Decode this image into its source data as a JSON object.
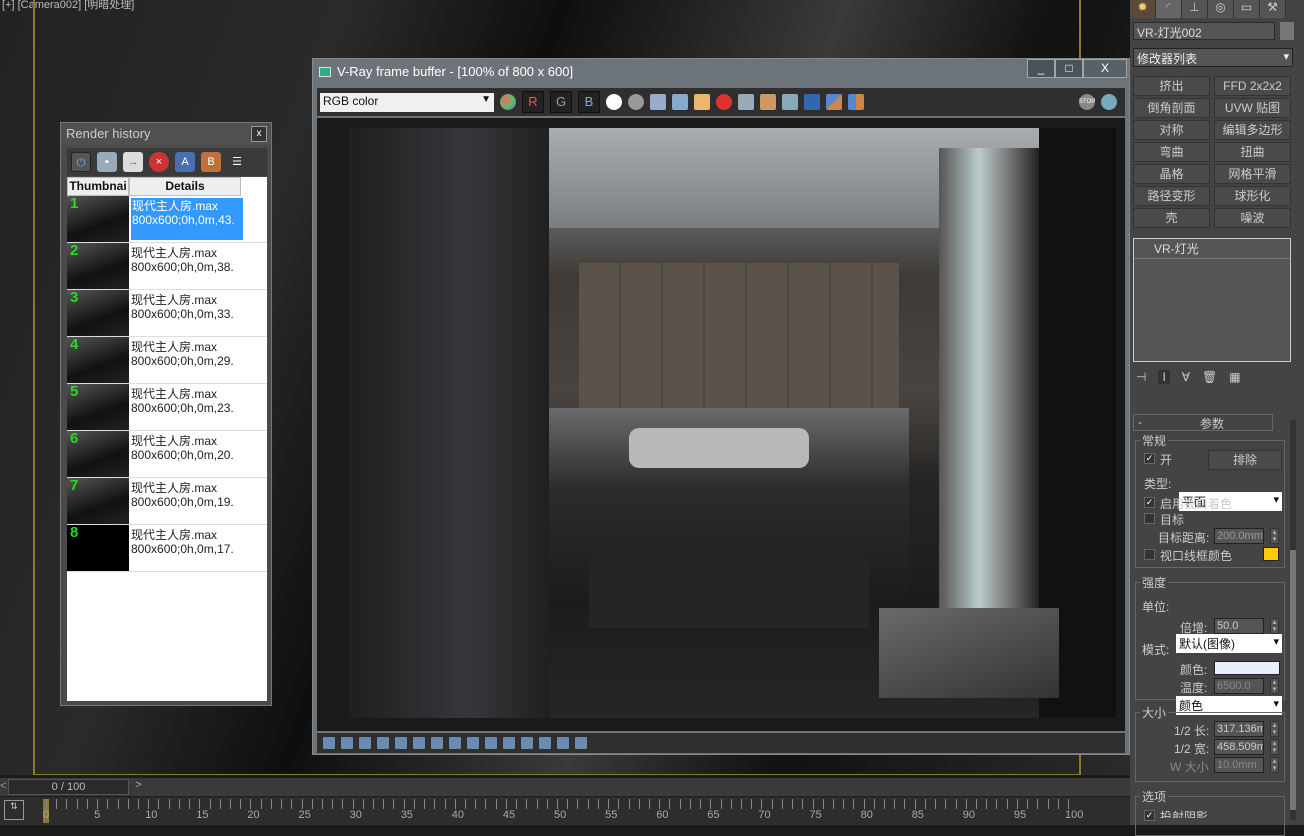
{
  "viewport": {
    "label": "[+] [Camera002] [明暗处理]"
  },
  "render_history": {
    "title": "Render history",
    "close": "x",
    "tools": [
      "power-icon",
      "save-icon",
      "export-icon",
      "delete-icon",
      "A",
      "B",
      "menu-icon"
    ],
    "columns": [
      "Thumbnai",
      "Details"
    ],
    "items": [
      {
        "n": "1",
        "file": "现代主人房.max",
        "info": "800x600;0h,0m,43."
      },
      {
        "n": "2",
        "file": "现代主人房.max",
        "info": "800x600;0h,0m,38."
      },
      {
        "n": "3",
        "file": "现代主人房.max",
        "info": "800x600;0h,0m,33."
      },
      {
        "n": "4",
        "file": "现代主人房.max",
        "info": "800x600;0h,0m,29."
      },
      {
        "n": "5",
        "file": "现代主人房.max",
        "info": "800x600;0h,0m,23."
      },
      {
        "n": "6",
        "file": "现代主人房.max",
        "info": "800x600;0h,0m,20."
      },
      {
        "n": "7",
        "file": "现代主人房.max",
        "info": "800x600;0h,0m,19."
      },
      {
        "n": "8",
        "file": "现代主人房.max",
        "info": "800x600;0h,0m,17."
      }
    ]
  },
  "vfb": {
    "title": "V-Ray frame buffer - [100% of 800 x 600]",
    "channel": "RGB color",
    "r": "R",
    "g": "G",
    "b": "B",
    "min": "_",
    "max": "□",
    "close": "X"
  },
  "timeline": {
    "frame": "0 / 100",
    "prev": "<",
    "next": ">",
    "ticks": [
      "0",
      "5",
      "10",
      "15",
      "20",
      "25",
      "30",
      "35",
      "40",
      "45",
      "50",
      "55",
      "60",
      "65",
      "70",
      "75",
      "80",
      "85",
      "90",
      "95",
      "100"
    ]
  },
  "panel": {
    "object_name": "VR-灯光002",
    "modifier_list": "修改器列表",
    "modifiers": [
      "挤出",
      "FFD 2x2x2",
      "倒角剖面",
      "UVW 贴图",
      "对称",
      "编辑多边形",
      "弯曲",
      "扭曲",
      "晶格",
      "网格平滑",
      "路径变形",
      "球形化",
      "壳",
      "噪波"
    ],
    "stack_item": "VR-灯光",
    "rollout": "参数",
    "collapse": "-",
    "general": {
      "label": "常规",
      "on": "开",
      "exclude": "排除",
      "type_label": "类型:",
      "type": "平面",
      "viewport_shading": "启用视口着色",
      "target": "目标",
      "target_dist_label": "目标距离:",
      "target_dist": "200.0mm",
      "wire_color": "视口线框颜色"
    },
    "intensity": {
      "label": "强度",
      "unit_label": "单位:",
      "unit": "默认(图像)",
      "mult_label": "倍增:",
      "mult": "50.0",
      "mode_label": "模式:",
      "mode": "颜色",
      "color_label": "颜色:",
      "temp_label": "温度:",
      "temp": "6500.0"
    },
    "size": {
      "label": "大小",
      "half_len_label": "1/2 长:",
      "half_len": "317.136m",
      "half_wid_label": "1/2 宽:",
      "half_wid": "458.509m",
      "w_label": "W 大小",
      "w": "10.0mm"
    },
    "options": {
      "label": "选项",
      "cast_shadows": "投射阴影"
    }
  },
  "colors": {
    "wire": "#ffcc00",
    "light": "#e8f0ff",
    "selection": "#3399ff"
  }
}
